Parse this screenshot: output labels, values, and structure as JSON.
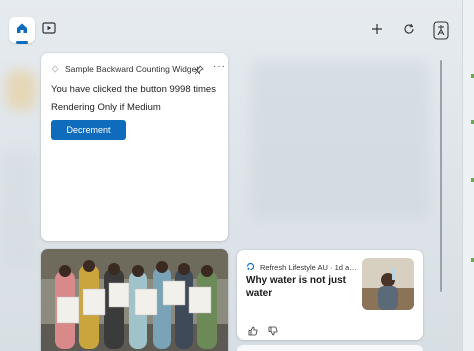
{
  "nav": {
    "home_icon": "home-icon",
    "video_icon": "play-video-icon"
  },
  "toolbar": {
    "add_icon": "plus-icon",
    "refresh_icon": "refresh-icon",
    "profile_icon": "profile-badge-icon"
  },
  "widget": {
    "title": "Sample Backward Counting Widget",
    "click_text": "You have clicked the button 9998 times",
    "render_text": "Rendering Only if Medium",
    "button_label": "Decrement"
  },
  "news": {
    "source": "Refresh Lifestyle AU · 1d a…",
    "title": "Why water is not just water"
  },
  "colors": {
    "accent": "#0f6cbd",
    "card": "#ffffff",
    "background": "#e2e8ed"
  }
}
